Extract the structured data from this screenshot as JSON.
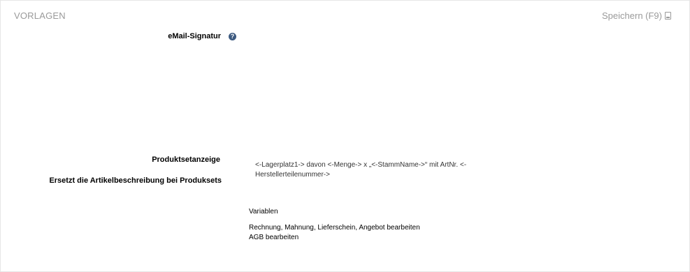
{
  "header": {
    "title": "VORLAGEN",
    "save_label": "Speichern (F9)",
    "save_icon": "save-icon"
  },
  "form": {
    "email_signature_label": "eMail-Signatur",
    "help_icon": "question-circle-icon",
    "product_set_label": "Produktsetanzeige",
    "product_set_sublabel": "Ersetzt die Artikelbeschreibung bei Produksets",
    "product_set_value": "<-Lagerplatz1-> davon <-Menge-> x „<-StammName->“ mit ArtNr. <-Herstellerteilenummer->"
  },
  "links": {
    "variables": "Variablen",
    "edit_documents": "Rechnung, Mahnung, Lieferschein, Angebot bearbeiten",
    "edit_agb": "AGB bearbeiten"
  }
}
